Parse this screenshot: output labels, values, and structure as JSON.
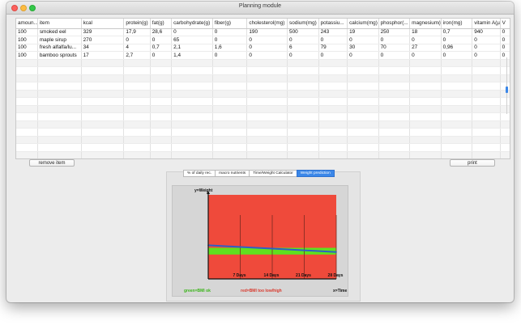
{
  "window": {
    "title": "Planning module"
  },
  "table": {
    "columns": [
      "amoun...",
      "item",
      "kcal",
      "protein(g)",
      "fat(g)",
      "carbohydrate(g)",
      "fiber(g)",
      "cholesterol(mg)",
      "sodium(mg)",
      "potassiu...",
      "calcium(mg)",
      "phosphor(...",
      "magnesium(mg)",
      "iron(mg)",
      "vitamin A(µg)",
      "V"
    ],
    "rows": [
      [
        "100",
        "smoked eel",
        "329",
        "17,9",
        "28,6",
        "0",
        "0",
        "190",
        "500",
        "243",
        "19",
        "250",
        "18",
        "0,7",
        "940",
        "0"
      ],
      [
        "100",
        "maple sirup",
        "270",
        "0",
        "0",
        "65",
        "0",
        "0",
        "0",
        "0",
        "0",
        "0",
        "0",
        "0",
        "0",
        "0"
      ],
      [
        "100",
        "fresh alfalfa/lu...",
        "34",
        "4",
        "0,7",
        "2,1",
        "1,6",
        "0",
        "6",
        "79",
        "30",
        "70",
        "27",
        "0,96",
        "0",
        "0"
      ],
      [
        "100",
        "bamboo sprouts",
        "17",
        "2,7",
        "0",
        "1,4",
        "0",
        "0",
        "0",
        "0",
        "0",
        "0",
        "0",
        "0",
        "0",
        "0"
      ]
    ],
    "empty_row_count": 14
  },
  "buttons": {
    "remove": "remove item",
    "print": "print"
  },
  "tabs": [
    {
      "label": "% of daily rec.",
      "active": false
    },
    {
      "label": "macro nutrients",
      "active": false
    },
    {
      "label": "Time/Weight Calculator",
      "active": false
    },
    {
      "label": "Weight prediction",
      "active": true
    }
  ],
  "chart": {
    "ylabel": "y=Weight",
    "xlabel": "x=Time",
    "legend_green": "green=BMI ok",
    "legend_red": "red=BMI too low/high",
    "colors": {
      "plot_bg": "#ef4a3b",
      "green_band": "#5fe01f",
      "weight_line": "#2f5fc4",
      "grid": "#7a2a22",
      "axis": "#111111",
      "legend_green": "#3bb51a",
      "legend_red": "#d93a2e"
    }
  },
  "chart_data": {
    "type": "line",
    "x": [
      0,
      7,
      14,
      21,
      28
    ],
    "xticks": [
      {
        "value": 7,
        "label": "7 Days"
      },
      {
        "value": 14,
        "label": "14 Days"
      },
      {
        "value": 21,
        "label": "21 Days"
      },
      {
        "value": 28,
        "label": "28 Days"
      }
    ],
    "xlim": [
      0,
      28
    ],
    "series": [
      {
        "values": [
          0.4,
          0.38,
          0.36,
          0.34,
          0.32
        ]
      }
    ],
    "green_band": [
      {
        "from": 0.29,
        "to": 0.37
      }
    ],
    "ylim": [
      0,
      1.0
    ]
  }
}
